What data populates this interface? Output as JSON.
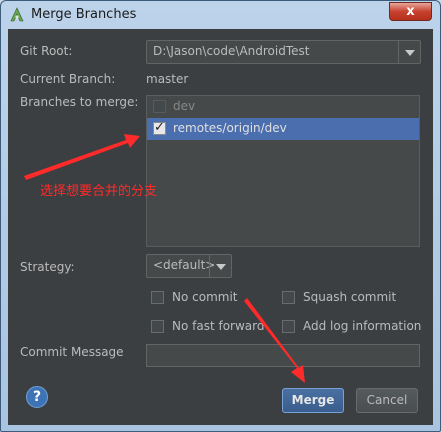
{
  "window": {
    "title": "Merge Branches",
    "close_label": "x"
  },
  "form": {
    "git_root_label": "Git Root:",
    "git_root_value": "D:\\Jason\\code\\AndroidTest",
    "current_branch_label": "Current Branch:",
    "current_branch_value": "master",
    "branches_label": "Branches to merge:",
    "branches": [
      {
        "name": "dev",
        "checked": false
      },
      {
        "name": "remotes/origin/dev",
        "checked": true
      }
    ],
    "strategy_label": "Strategy:",
    "strategy_value": "<default>",
    "options": [
      {
        "label": "No commit",
        "checked": false
      },
      {
        "label": "Squash commit",
        "checked": false
      },
      {
        "label": "No fast forward",
        "checked": false
      },
      {
        "label": "Add log information",
        "checked": false
      }
    ],
    "commit_message_label": "Commit Message",
    "commit_message_value": ""
  },
  "buttons": {
    "help": "?",
    "merge": "Merge",
    "cancel": "Cancel"
  },
  "annotation": {
    "text": "选择想要合并的分支",
    "color": "#ff2a2a"
  },
  "colors": {
    "dialog_bg": "#3c3f41",
    "selection": "#4b6eaf",
    "annotation": "#ff2a2a"
  }
}
